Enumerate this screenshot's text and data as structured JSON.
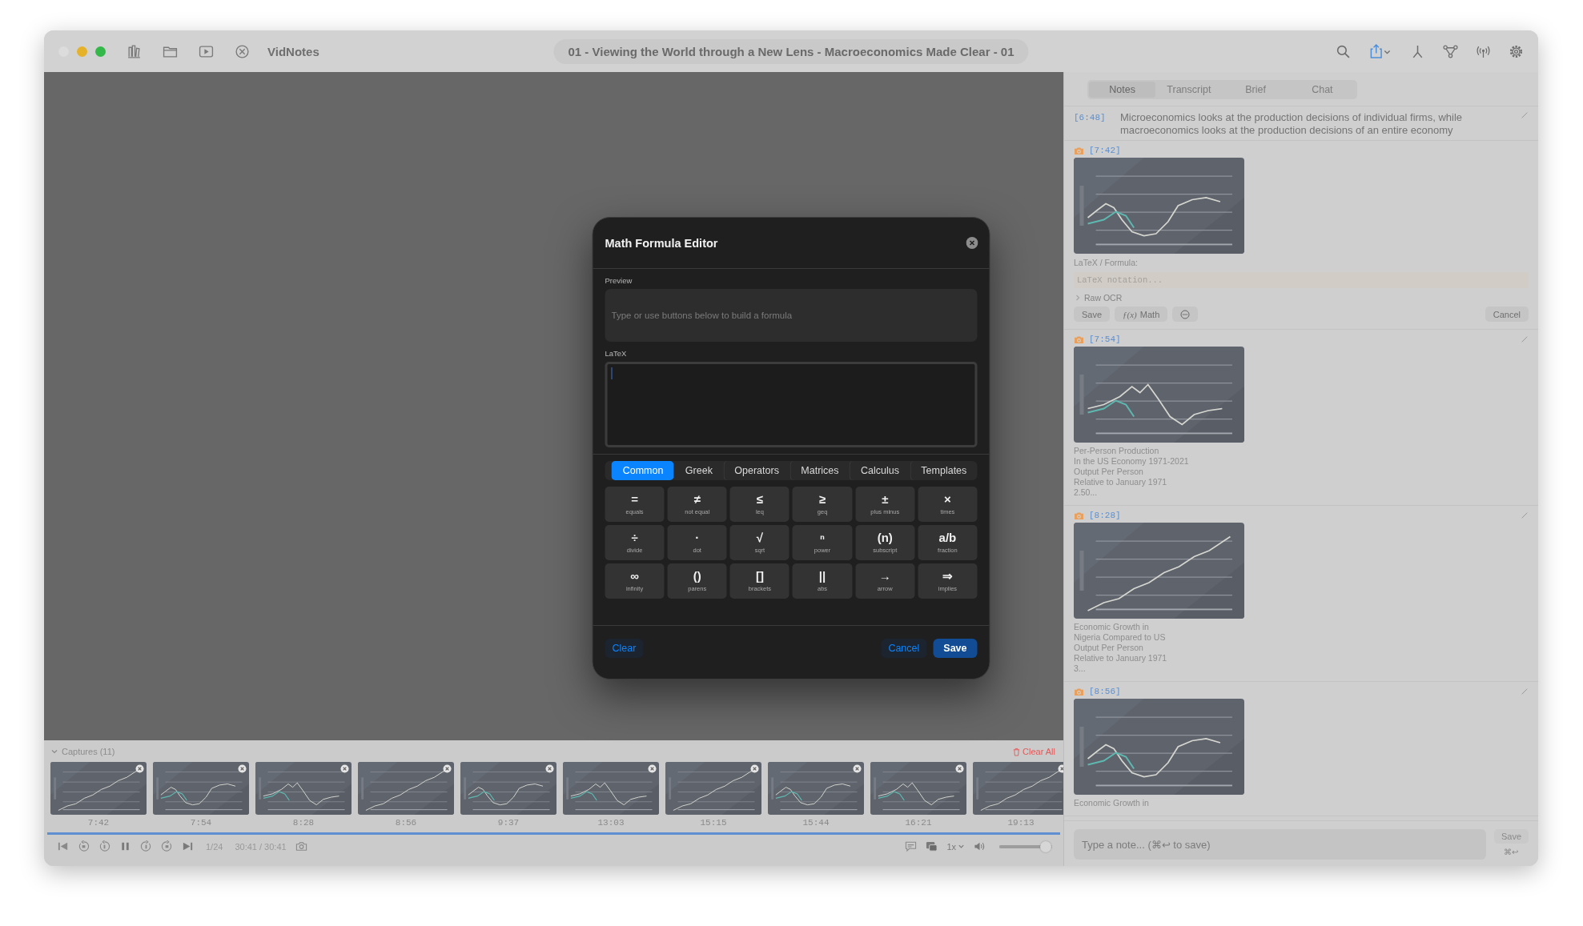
{
  "window": {
    "app_name": "VidNotes",
    "title": "01 - Viewing the World through a New Lens - Macroeconomics Made Clear - 01"
  },
  "modal": {
    "title": "Math Formula Editor",
    "preview_label": "Preview",
    "preview_placeholder": "Type or use buttons below to build a formula",
    "latex_label": "LaTeX",
    "tabs": [
      {
        "label": "Common",
        "selected": true
      },
      {
        "label": "Greek",
        "selected": false
      },
      {
        "label": "Operators",
        "selected": false
      },
      {
        "label": "Matrices",
        "selected": false
      },
      {
        "label": "Calculus",
        "selected": false
      },
      {
        "label": "Templates",
        "selected": false
      }
    ],
    "keys": [
      {
        "symbol": "=",
        "label": "equals"
      },
      {
        "symbol": "≠",
        "label": "not equal"
      },
      {
        "symbol": "≤",
        "label": "leq"
      },
      {
        "symbol": "≥",
        "label": "geq"
      },
      {
        "symbol": "±",
        "label": "plus minus"
      },
      {
        "symbol": "×",
        "label": "times"
      },
      {
        "symbol": "÷",
        "label": "divide"
      },
      {
        "symbol": "·",
        "label": "dot"
      },
      {
        "symbol": "√",
        "label": "sqrt"
      },
      {
        "symbol": "ⁿ",
        "label": "power"
      },
      {
        "symbol": "(n)",
        "label": "subscript"
      },
      {
        "symbol": "a/b",
        "label": "fraction"
      },
      {
        "symbol": "∞",
        "label": "infinity"
      },
      {
        "symbol": "()",
        "label": "parens"
      },
      {
        "symbol": "[]",
        "label": "brackets"
      },
      {
        "symbol": "||",
        "label": "abs"
      },
      {
        "symbol": "→",
        "label": "arrow"
      },
      {
        "symbol": "⇒",
        "label": "implies"
      }
    ],
    "clear": "Clear",
    "cancel": "Cancel",
    "save": "Save"
  },
  "captures_bar": {
    "title": "Captures (11)",
    "expanded": true,
    "clear_label": "Clear All",
    "items": [
      {
        "time": "7:42"
      },
      {
        "time": "7:54"
      },
      {
        "time": "8:28"
      },
      {
        "time": "8:56"
      },
      {
        "time": "9:37"
      },
      {
        "time": "13:03"
      },
      {
        "time": "15:15"
      },
      {
        "time": "15:44"
      },
      {
        "time": "16:21"
      },
      {
        "time": "19:13"
      }
    ]
  },
  "player": {
    "progress": {
      "level": 1.0
    },
    "position": "1/24",
    "time": "30:41 / 30:41",
    "speed": "1x",
    "volume": {
      "level": 0.88
    }
  },
  "side_panel": {
    "tabs": [
      {
        "label": "Notes",
        "selected": true
      },
      {
        "label": "Transcript",
        "selected": false
      },
      {
        "label": "Brief",
        "selected": false
      },
      {
        "label": "Chat",
        "selected": false
      }
    ],
    "entries": [
      {
        "kind": "note",
        "time": "[6:48]",
        "text": "Microeconomics looks at the production decisions of individual firms, while macroeconomics looks at the production decisions of an entire economy"
      },
      {
        "kind": "capture",
        "time": "[7:42]",
        "editing": true,
        "formula_label": "LaTeX / Formula:",
        "formula_placeholder": "LaTeX notation...",
        "raw_ocr": {
          "label": "Raw OCR",
          "expanded": false
        },
        "save": "Save",
        "math_icon": "ƒ(x)",
        "math": "Math",
        "cancel": "Cancel"
      },
      {
        "kind": "capture",
        "time": "[7:54]",
        "editing": false,
        "caption": [
          "Per-Person Production",
          "In the US Economy 1971-2021",
          "Output Per Person",
          "Relative to January 1971",
          "2.50..."
        ]
      },
      {
        "kind": "capture",
        "time": "[8:28]",
        "editing": false,
        "caption": [
          "Economic Growth in",
          "Nigeria Compared to US",
          "Output Per Person",
          "Relative to January 1971",
          "3..."
        ]
      },
      {
        "kind": "capture",
        "time": "[8:56]",
        "editing": false,
        "caption": [
          "Economic Growth in"
        ]
      }
    ],
    "note_input": {
      "placeholder": "Type a note... (⌘↩ to save)",
      "save": "Save",
      "save_disabled": true,
      "shortcut": "⌘↩"
    }
  }
}
